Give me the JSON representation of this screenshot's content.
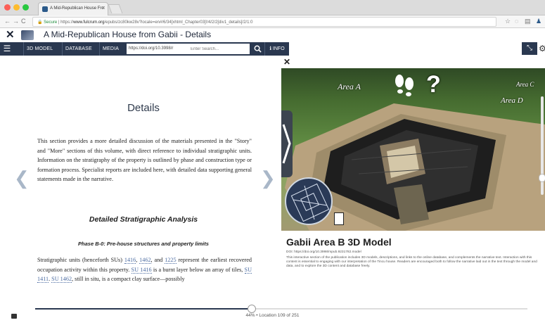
{
  "browser": {
    "tab_title": "A Mid-Republican House Fro:",
    "tab_close": "×",
    "url_secure_label": "Secure",
    "url_scheme": "https://",
    "url_host": "www.fulcrum.org",
    "url_path": "/epubs/zc80kw28v?locale=en#/6/34[xhtml_Chapter03]!/4/2/2[div1_details]/2/1:0"
  },
  "app": {
    "title": "A Mid-Republican House from Gabii - Details",
    "close_glyph": "✕"
  },
  "toolbar": {
    "menu_glyph": "☰",
    "buttons": [
      "3D MODEL",
      "DATABASE",
      "MEDIA"
    ],
    "doi_value": "https://doi.org/10.3998/r",
    "search_placeholder": "Enter Search...",
    "search_glyph": "🔍",
    "info_label": "ℹ INFO"
  },
  "reader": {
    "heading": "Details",
    "intro": "This section provides a more detailed discussion of the materials presented in the \"Story\" and \"More\" sections of this volume, with direct reference to individual stratigraphic units. Information on the stratigraphy of the property is outlined by phase and construction type or formation process. Specialist reports are included here, with detailed data supporting general statements made in the narrative.",
    "section_heading": "Detailed Stratigraphic Analysis",
    "phase_heading": "Phase B-0: Pre-house structures and property limits",
    "p2": {
      "t1": "Stratigraphic units (henceforth SUs) ",
      "l1": "1416",
      "t2": ", ",
      "l2": "1462",
      "t3": ", and ",
      "l3": "1225",
      "t4": " represent the earliest recovered occupation activity within this property. ",
      "l4": "SU 1416",
      "t5": " is a burnt layer below an array of tiles, ",
      "l5": "SU 1411",
      "t6": ". ",
      "l6": "SU 1462",
      "t7": ", still in situ, is a compact clay surface—possibly"
    },
    "prev_glyph": "❮",
    "next_glyph": "❯"
  },
  "viewer": {
    "close_glyph": "✕",
    "labels": {
      "area_a": "Area A",
      "area_c": "Area C",
      "area_d": "Area D"
    },
    "question_glyph": "?",
    "fullscreen_glyph": "⤡",
    "gear_glyph": "⚙",
    "model_title": "Gabii Area B 3D Model",
    "model_doi": "DOI: https://doi.org/10.3998/mpub.9231782.model",
    "model_desc": "This interactive section of the publication includes 3D models, descriptions, and links to the online database, and complements the narrative text. Interaction with this content is essential to engaging with our interpretation of the Tincu house. Readers are encouraged both to follow the narrative laid out in the text through the model and data, and to explore the 3D content and database freely.",
    "scroll_level": 0.8
  },
  "progress": {
    "percent": 44,
    "label": "44% • Location 109 of 251"
  },
  "colors": {
    "toolbar_bg": "#2a3850",
    "link": "#4a6aa0"
  }
}
